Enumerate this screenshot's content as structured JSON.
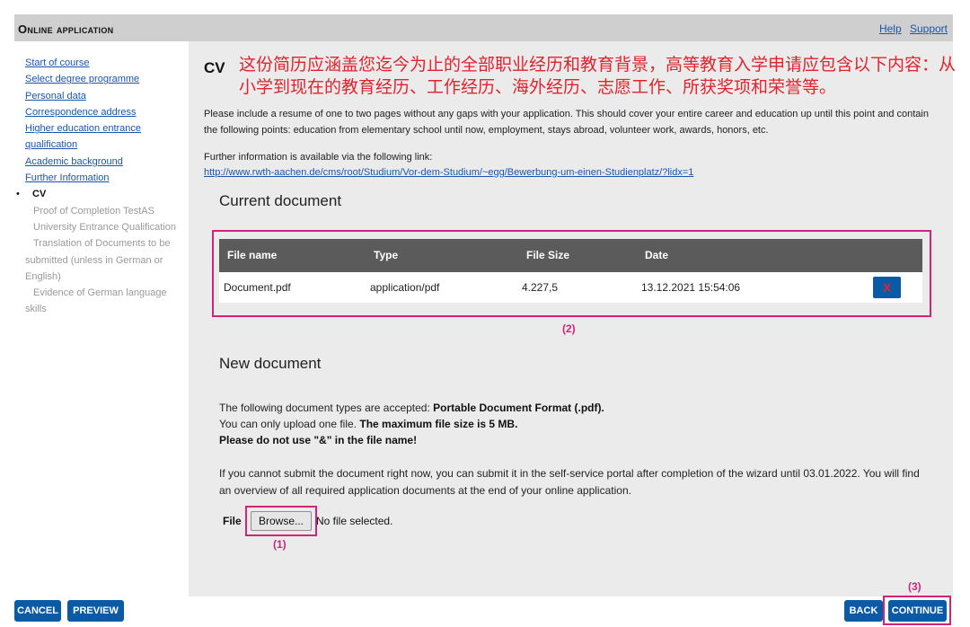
{
  "header": {
    "title": "Online application",
    "links": [
      "Help",
      "Support"
    ]
  },
  "sidebar": {
    "links": [
      "Start of course",
      "Select degree programme",
      "Personal data",
      "Correspondence address"
    ],
    "higher_edu": [
      "Higher education entrance",
      "qualification"
    ],
    "links2": [
      "Academic background",
      "Further Information"
    ],
    "current": "CV",
    "sub": {
      "testas": "Proof of Completion TestAS",
      "uni": "University Entrance Qualification",
      "translation_1": "Translation of Documents to be",
      "translation_2": "submitted (unless in German or",
      "translation_3": "English)",
      "german_1": "Evidence of German language",
      "german_2": "skills"
    }
  },
  "main": {
    "title": "CV",
    "cn_note": "这份简历应涵盖您迄今为止的全部职业经历和教育背景，高等教育入学申请应包含以下内容：从小学到现在的教育经历、工作经历、海外经历、志愿工作、所获奖项和荣誉等。",
    "intro": "Please include a resume of one to two pages without any gaps with your application. This should cover your entire career and education up until this point and contain the following points: education from elementary school until now, employment, stays abroad, volunteer work, awards, honors, etc.",
    "more_info": "Further information is available via the following link:",
    "link_url": "http://www.rwth-aachen.de/cms/root/Studium/Vor-dem-Studium/~egg/Bewerbung-um-einen-Studienplatz/?lidx=1"
  },
  "current_doc": {
    "title": "Current document",
    "columns": [
      "File name",
      "Type",
      "File Size",
      "Date"
    ],
    "row": {
      "name": "Document.pdf",
      "type": "application/pdf",
      "size": "4.227,5",
      "date": "13.12.2021 15:54:06",
      "delete": "X"
    }
  },
  "new_doc": {
    "title": "New document",
    "accepted_prefix": "The following document types are accepted: ",
    "accepted_format": "Portable Document Format (.pdf).",
    "one_file": "You can only upload one file. ",
    "max_size": "The maximum file size is 5 MB.",
    "no_amp": "Please do not use \"&\" in the file name!",
    "notice": "If you cannot submit the document right now, you can submit it in the self-service portal after completion of the wizard until 03.01.2022. You will find an overview of all required application documents at the end of your online application.",
    "file_label": "File",
    "browse": "Browse...",
    "no_file": "No file selected."
  },
  "annotations": {
    "a1": "(1)",
    "a2": "(2)",
    "a3": "(3)"
  },
  "footer": {
    "cancel": "CANCEL",
    "preview": "PREVIEW",
    "back": "BACK",
    "continue": "CONTINUE"
  },
  "colors": {
    "accent_blue": "#0b5aa6",
    "annotation": "#d0247a",
    "note_red": "#e0232e"
  }
}
